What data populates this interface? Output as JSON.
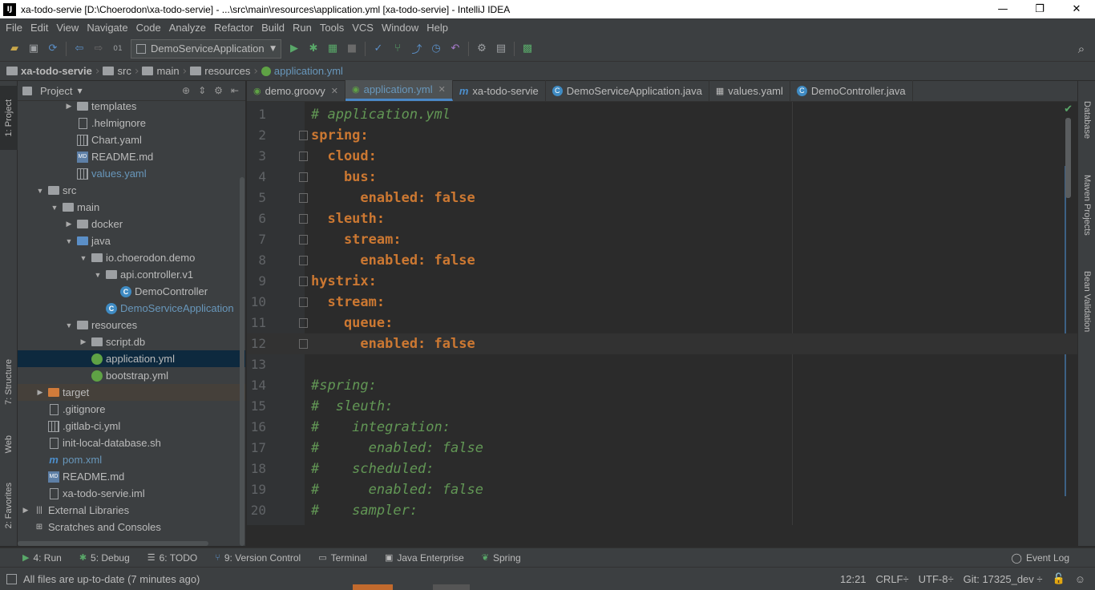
{
  "window": {
    "title": "xa-todo-servie [D:\\Choerodon\\xa-todo-servie] - ...\\src\\main\\resources\\application.yml [xa-todo-servie] - IntelliJ IDEA",
    "app_icon": "IJ",
    "minimize": "—",
    "restore": "❐",
    "close": "✕"
  },
  "menu": [
    "File",
    "Edit",
    "View",
    "Navigate",
    "Code",
    "Analyze",
    "Refactor",
    "Build",
    "Run",
    "Tools",
    "VCS",
    "Window",
    "Help"
  ],
  "toolbar": {
    "run_config": "DemoServiceApplication"
  },
  "breadcrumb": [
    "xa-todo-servie",
    "src",
    "main",
    "resources",
    "application.yml"
  ],
  "left_strip": {
    "project": "1: Project",
    "structure": "7: Structure",
    "web": "Web",
    "favorites": "2: Favorites"
  },
  "right_strip": {
    "database": "Database",
    "maven": "Maven Projects",
    "bean": "Bean Validation"
  },
  "project_panel": {
    "title": "Project",
    "tree": [
      {
        "label": "templates",
        "indent": 3,
        "arrow": "▶",
        "icon": "folder"
      },
      {
        "label": ".helmignore",
        "indent": 3,
        "arrow": "",
        "icon": "file"
      },
      {
        "label": "Chart.yaml",
        "indent": 3,
        "arrow": "",
        "icon": "grid"
      },
      {
        "label": "README.md",
        "indent": 3,
        "arrow": "",
        "icon": "md"
      },
      {
        "label": "values.yaml",
        "indent": 3,
        "arrow": "",
        "icon": "grid",
        "blue": true
      },
      {
        "label": "src",
        "indent": 1,
        "arrow": "▼",
        "icon": "folder"
      },
      {
        "label": "main",
        "indent": 2,
        "arrow": "▼",
        "icon": "folder"
      },
      {
        "label": "docker",
        "indent": 3,
        "arrow": "▶",
        "icon": "folder"
      },
      {
        "label": "java",
        "indent": 3,
        "arrow": "▼",
        "icon": "folder-blue"
      },
      {
        "label": "io.choerodon.demo",
        "indent": 4,
        "arrow": "▼",
        "icon": "folder"
      },
      {
        "label": "api.controller.v1",
        "indent": 5,
        "arrow": "▼",
        "icon": "folder"
      },
      {
        "label": "DemoController",
        "indent": 6,
        "arrow": "",
        "icon": "class"
      },
      {
        "label": "DemoServiceApplication",
        "indent": 5,
        "arrow": "",
        "icon": "class",
        "blue": true
      },
      {
        "label": "resources",
        "indent": 3,
        "arrow": "▼",
        "icon": "folder"
      },
      {
        "label": "script.db",
        "indent": 4,
        "arrow": "▶",
        "icon": "folder"
      },
      {
        "label": "application.yml",
        "indent": 4,
        "arrow": "",
        "icon": "spring",
        "selected": true
      },
      {
        "label": "bootstrap.yml",
        "indent": 4,
        "arrow": "",
        "icon": "spring"
      },
      {
        "label": "target",
        "indent": 1,
        "arrow": "▶",
        "icon": "folder-orange",
        "excluded": true
      },
      {
        "label": ".gitignore",
        "indent": 1,
        "arrow": "",
        "icon": "file"
      },
      {
        "label": ".gitlab-ci.yml",
        "indent": 1,
        "arrow": "",
        "icon": "grid"
      },
      {
        "label": "init-local-database.sh",
        "indent": 1,
        "arrow": "",
        "icon": "file"
      },
      {
        "label": "pom.xml",
        "indent": 1,
        "arrow": "",
        "icon": "m",
        "blue": true
      },
      {
        "label": "README.md",
        "indent": 1,
        "arrow": "",
        "icon": "md"
      },
      {
        "label": "xa-todo-servie.iml",
        "indent": 1,
        "arrow": "",
        "icon": "file"
      },
      {
        "label": "External Libraries",
        "indent": 0,
        "arrow": "▶",
        "icon": "lib"
      },
      {
        "label": "Scratches and Consoles",
        "indent": 0,
        "arrow": "",
        "icon": "scratch"
      }
    ]
  },
  "tabs": [
    {
      "label": "demo.groovy",
      "icon": "◉",
      "active": false
    },
    {
      "label": "application.yml",
      "icon": "◉",
      "active": true
    },
    {
      "label": "xa-todo-servie",
      "icon": "m",
      "active": false
    },
    {
      "label": "DemoServiceApplication.java",
      "icon": "C",
      "active": false
    },
    {
      "label": "values.yaml",
      "icon": "▦",
      "active": false
    },
    {
      "label": "DemoController.java",
      "icon": "C",
      "active": false
    }
  ],
  "editor": {
    "lines": [
      {
        "n": "1",
        "text": "# application.yml",
        "kind": "comment"
      },
      {
        "n": "2",
        "text": "spring:",
        "kind": "key"
      },
      {
        "n": "3",
        "text": "  cloud:",
        "kind": "key"
      },
      {
        "n": "4",
        "text": "    bus:",
        "kind": "key"
      },
      {
        "n": "5",
        "text": "      enabled: false",
        "kind": "key"
      },
      {
        "n": "6",
        "text": "  sleuth:",
        "kind": "key"
      },
      {
        "n": "7",
        "text": "    stream:",
        "kind": "key"
      },
      {
        "n": "8",
        "text": "      enabled: false",
        "kind": "key"
      },
      {
        "n": "9",
        "text": "hystrix:",
        "kind": "key"
      },
      {
        "n": "10",
        "text": "  stream:",
        "kind": "key"
      },
      {
        "n": "11",
        "text": "    queue:",
        "kind": "key"
      },
      {
        "n": "12",
        "text": "      enabled: false",
        "kind": "key",
        "current": true
      },
      {
        "n": "13",
        "text": "",
        "kind": "key"
      },
      {
        "n": "14",
        "text": "#spring:",
        "kind": "comment"
      },
      {
        "n": "15",
        "text": "#  sleuth:",
        "kind": "comment"
      },
      {
        "n": "16",
        "text": "#    integration:",
        "kind": "comment"
      },
      {
        "n": "17",
        "text": "#      enabled: false",
        "kind": "comment"
      },
      {
        "n": "18",
        "text": "#    scheduled:",
        "kind": "comment"
      },
      {
        "n": "19",
        "text": "#      enabled: false",
        "kind": "comment"
      },
      {
        "n": "20",
        "text": "#    sampler:",
        "kind": "comment"
      }
    ]
  },
  "bottom_tools": [
    {
      "label": "4: Run",
      "icon": "▶"
    },
    {
      "label": "5: Debug",
      "icon": "✱"
    },
    {
      "label": "6: TODO",
      "icon": "☰"
    },
    {
      "label": "9: Version Control",
      "icon": "⑂"
    },
    {
      "label": "Terminal",
      "icon": "▭"
    },
    {
      "label": "Java Enterprise",
      "icon": "▣"
    },
    {
      "label": "Spring",
      "icon": "❦"
    }
  ],
  "event_log": "Event Log",
  "status": {
    "message": "All files are up-to-date (7 minutes ago)",
    "position": "12:21",
    "line_sep": "CRLF÷",
    "encoding": "UTF-8÷",
    "git": "Git: 17325_dev ÷"
  },
  "colors": {
    "comment": "#629755",
    "keyword": "#cc7832",
    "selection": "#0d293e",
    "accent": "#4a88c7"
  }
}
